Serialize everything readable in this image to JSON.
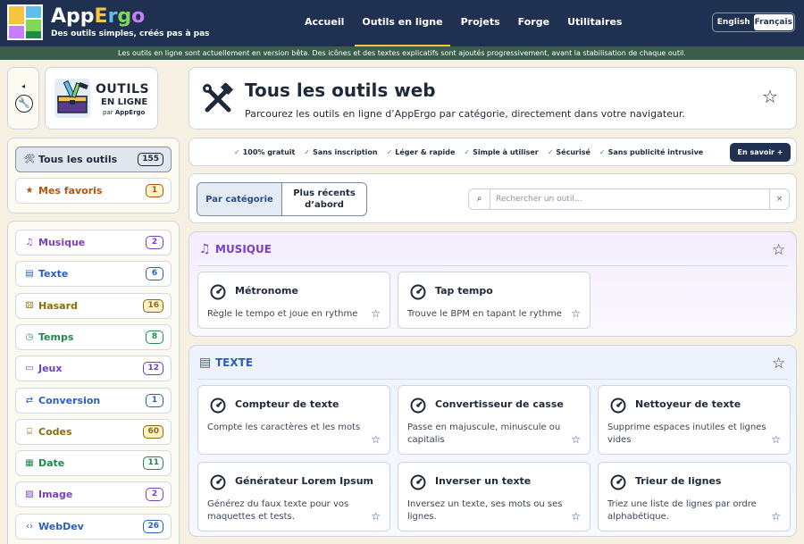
{
  "header": {
    "brand": {
      "app": "App",
      "e": "E",
      "r": "r",
      "g": "g",
      "o": "o"
    },
    "tagline": "Des outils simples, créés pas à pas",
    "nav": [
      "Accueil",
      "Outils en ligne",
      "Projets",
      "Forge",
      "Utilitaires"
    ],
    "nav_active": "Outils en ligne",
    "languages": [
      "English",
      "Français"
    ],
    "language_selected": "Français"
  },
  "beta_notice": "Les outils en ligne sont actuellement en version bêta. Des icônes et des textes explicatifs sont ajoutés progressivement, avant la stabilisation de chaque outil.",
  "sidebar": {
    "collapse_arrow": "◂",
    "logo": {
      "line1": "OUTILS",
      "line2": "EN LIGNE",
      "by": "par",
      "by_brand": "AppErgo"
    },
    "primary": [
      {
        "label": "Tous les outils",
        "count": "155",
        "icon": "wrench-hammer-icon",
        "glyph": "🛠",
        "color": "#1e2a3a",
        "selected": true
      },
      {
        "label": "Mes favoris",
        "count": "1",
        "icon": "star-icon",
        "glyph": "★",
        "color": "#b5540d",
        "selected": false
      }
    ],
    "categories": [
      {
        "label": "Musique",
        "count": "2",
        "icon": "music-note-icon",
        "glyph": "♫",
        "color": "#7b3fc4"
      },
      {
        "label": "Texte",
        "count": "6",
        "icon": "document-icon",
        "glyph": "▤",
        "color": "#2a5fb8"
      },
      {
        "label": "Hasard",
        "count": "16",
        "icon": "dice-icon",
        "glyph": "⚄",
        "color": "#8a6d0b"
      },
      {
        "label": "Temps",
        "count": "8",
        "icon": "clock-icon",
        "glyph": "◷",
        "color": "#1f8a4c"
      },
      {
        "label": "Jeux",
        "count": "12",
        "icon": "gamepad-icon",
        "glyph": "▭",
        "color": "#6a3fc4"
      },
      {
        "label": "Conversion",
        "count": "1",
        "icon": "exchange-icon",
        "glyph": "⇄",
        "color": "#2a5fb8"
      },
      {
        "label": "Codes",
        "count": "60",
        "icon": "barcode-icon",
        "glyph": "⌸",
        "color": "#8a6d0b"
      },
      {
        "label": "Date",
        "count": "11",
        "icon": "calendar-icon",
        "glyph": "▦",
        "color": "#1f8a4c"
      },
      {
        "label": "Image",
        "count": "2",
        "icon": "image-icon",
        "glyph": "▨",
        "color": "#7b3fc4"
      },
      {
        "label": "WebDev",
        "count": "26",
        "icon": "code-icon",
        "glyph": "‹›",
        "color": "#2a5fb8"
      }
    ]
  },
  "hero": {
    "title": "Tous les outils web",
    "subtitle": "Parcourez les outils en ligne d’AppErgo par catégorie, directement dans votre navigateur."
  },
  "features": {
    "items": [
      "100% gratuit",
      "Sans inscription",
      "Léger & rapide",
      "Simple à utiliser",
      "Sécurisé",
      "Sans publicité intrusive"
    ],
    "more": "En savoir +"
  },
  "filters": {
    "tabs": [
      "Par catégorie",
      "Plus récents d’abord"
    ],
    "active_tab": "Par catégorie",
    "search_placeholder": "Rechercher un outil...",
    "clear": "×"
  },
  "sections": [
    {
      "title": "MUSIQUE",
      "color": "#7b3fc4",
      "icon": "music-note-icon",
      "tools": [
        {
          "name": "Métronome",
          "desc": "Règle le tempo et joue en rythme"
        },
        {
          "name": "Tap tempo",
          "desc": "Trouve le BPM en tapant le rythme"
        }
      ]
    },
    {
      "title": "TEXTE",
      "color": "#2a5fb8",
      "icon": "document-icon",
      "tools": [
        {
          "name": "Compteur de texte",
          "desc": "Compte les caractères et les mots"
        },
        {
          "name": "Convertisseur de casse",
          "desc": "Passe en majuscule, minuscule ou capitalis"
        },
        {
          "name": "Nettoyeur de texte",
          "desc": "Supprime espaces inutiles et lignes vides"
        },
        {
          "name": "Générateur Lorem Ipsum",
          "desc": "Générez du faux texte pour vos maquettes et tests."
        },
        {
          "name": "Inverser un texte",
          "desc": "Inversez un texte, ses mots ou ses lignes."
        },
        {
          "name": "Trieur de lignes",
          "desc": "Triez une liste de lignes par ordre alphabétique."
        }
      ]
    }
  ]
}
